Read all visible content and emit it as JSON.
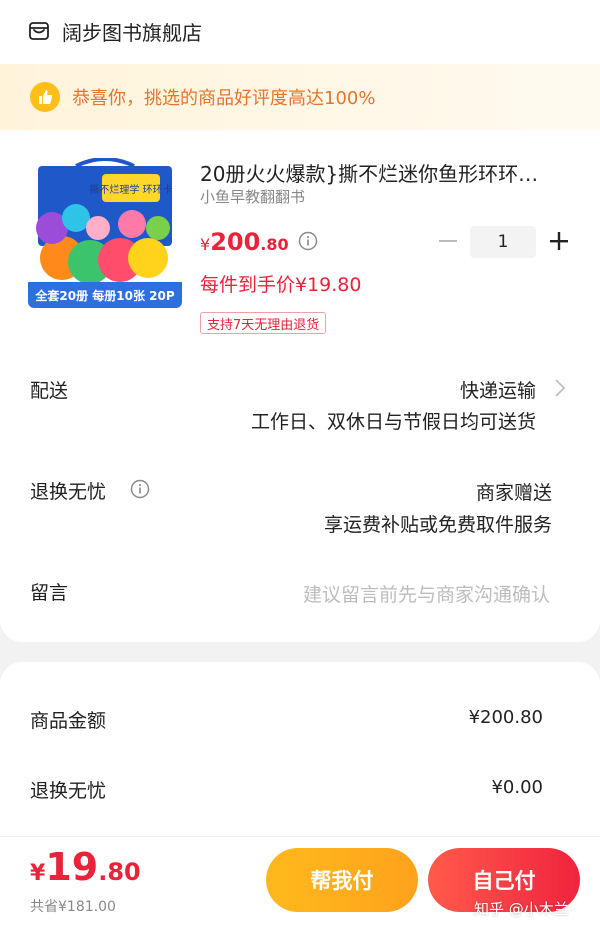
{
  "shop": {
    "name": "阔步图书旗舰店",
    "icon": "shop-icon"
  },
  "banner": {
    "text": "恭喜你，挑选的商品好评度高达100%",
    "icon": "thumbs-up-icon",
    "color": "#e8742a"
  },
  "product": {
    "title": "20册火火爆款}撕不烂迷你鱼形环环…",
    "subtitle": "小鱼早教翻翻书",
    "image_caption": "全套20册  每册10张  20P",
    "image_box_text": "撕不烂理学 环环卡",
    "price_yen": "¥",
    "price_int": "200",
    "price_dec": ".80",
    "unit_price": "每件到手价¥19.80",
    "tag": "支持7天无理由退货",
    "quantity": "1"
  },
  "rows": {
    "delivery_label": "配送",
    "delivery_method": "快递运输",
    "delivery_note": "工作日、双休日与节假日均可送货",
    "return_label": "退换无忧",
    "return_value": "商家赠送",
    "return_note": "享运费补贴或免费取件服务",
    "message_label": "留言",
    "message_placeholder": "建议留言前先与商家沟通确认"
  },
  "summary": {
    "goods_label": "商品金额",
    "goods_value": "¥200.80",
    "return_label": "退换无忧",
    "return_value": "¥0.00"
  },
  "bottom": {
    "total_yen": "¥",
    "total_int": "19",
    "total_dec": ".80",
    "saved": "共省¥181.00",
    "help_pay": "帮我付",
    "self_pay": "自己付"
  },
  "watermark": "知乎 @小木兰",
  "colors": {
    "accent_red": "#e8233a",
    "button_yellow": "#ffb01c",
    "button_red": "#f0233f"
  }
}
